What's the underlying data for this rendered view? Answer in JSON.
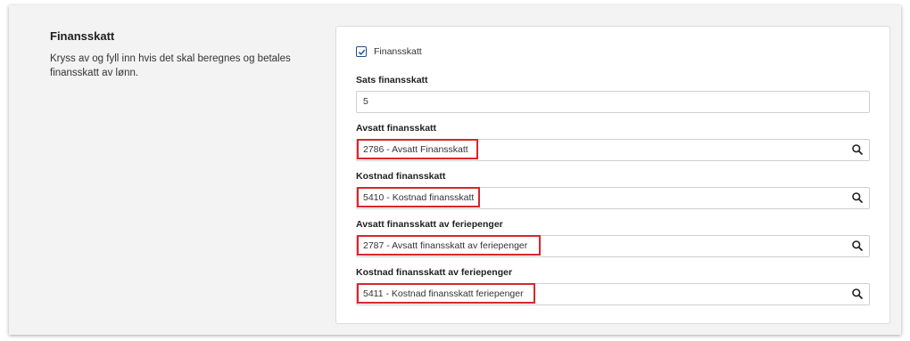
{
  "section": {
    "title": "Finansskatt",
    "description": "Kryss av og fyll inn hvis det skal beregnes og betales finansskatt av lønn."
  },
  "checkbox": {
    "label": "Finansskatt",
    "checked": true
  },
  "fields": {
    "sats": {
      "label": "Sats finansskatt",
      "value": "5"
    },
    "avsatt": {
      "label": "Avsatt finansskatt",
      "value": "2786 - Avsatt Finansskatt"
    },
    "kostnad": {
      "label": "Kostnad finansskatt",
      "value": "5410 - Kostnad finansskatt"
    },
    "avsatt_ferie": {
      "label": "Avsatt finansskatt av feriepenger",
      "value": "2787 - Avsatt finansskatt av feriepenger"
    },
    "kostnad_ferie": {
      "label": "Kostnad finansskatt av feriepenger",
      "value": "5411 - Kostnad finansskatt feriepenger"
    }
  },
  "icons": {
    "search": "search-icon",
    "check": "check-icon"
  },
  "colors": {
    "highlight": "#d9262c",
    "checkbox": "#1d4f8f"
  }
}
